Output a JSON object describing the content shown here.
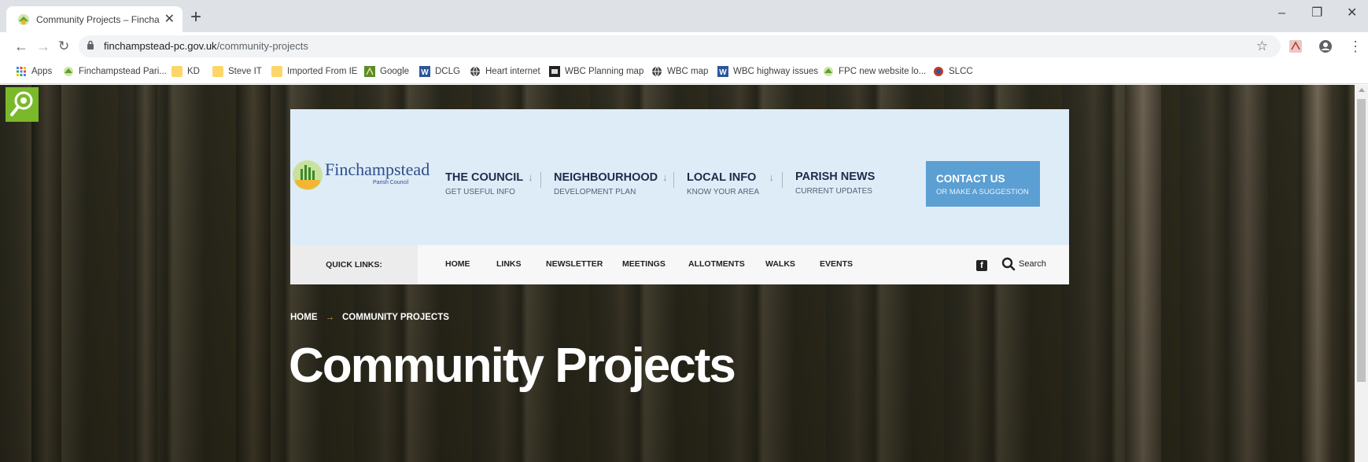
{
  "browser": {
    "tab": {
      "title": "Community Projects – Finchamp..."
    },
    "url_domain": "finchampstead-pc.gov.uk",
    "url_path": "/community-projects",
    "bookmarks": [
      {
        "label": "Apps",
        "icon": "apps-icon"
      },
      {
        "label": "Finchampstead Pari...",
        "icon": "fpc-favicon"
      },
      {
        "label": "KD",
        "icon": "folder-icon"
      },
      {
        "label": "Steve IT",
        "icon": "folder-icon"
      },
      {
        "label": "Imported From IE",
        "icon": "folder-icon"
      },
      {
        "label": "Google",
        "icon": "google-icon"
      },
      {
        "label": "DCLG",
        "icon": "w-icon"
      },
      {
        "label": "Heart internet",
        "icon": "globe-icon"
      },
      {
        "label": "WBC Planning map",
        "icon": "map-icon"
      },
      {
        "label": "WBC map",
        "icon": "globe-icon"
      },
      {
        "label": "WBC highway issues",
        "icon": "w-icon"
      },
      {
        "label": "FPC new website lo...",
        "icon": "fpc-favicon"
      },
      {
        "label": "SLCC",
        "icon": "slcc-icon"
      }
    ]
  },
  "site": {
    "logo": {
      "word": "Finchampstead",
      "sub": "Parish Council"
    },
    "nav": [
      {
        "title": "THE COUNCIL",
        "sub": "GET USEFUL INFO",
        "arrow": "↓"
      },
      {
        "title": "NEIGHBOURHOOD",
        "sub": "DEVELOPMENT PLAN",
        "arrow": "↓"
      },
      {
        "title": "LOCAL INFO",
        "sub": "KNOW YOUR AREA",
        "arrow": "↓"
      },
      {
        "title": "PARISH NEWS",
        "sub": "CURRENT UPDATES",
        "arrow": ""
      }
    ],
    "contact": {
      "title": "CONTACT US",
      "sub": "OR MAKE A SUGGESTION"
    },
    "quick_label": "QUICK LINKS:",
    "quick_links": [
      "HOME",
      "LINKS",
      "NEWSLETTER",
      "MEETINGS",
      "ALLOTMENTS",
      "WALKS",
      "EVENTS"
    ],
    "search_label": "Search",
    "breadcrumb": {
      "home": "HOME",
      "sep": "→",
      "current": "COMMUNITY PROJECTS"
    },
    "page_title": "Community Projects"
  },
  "colors": {
    "header_bg": "#deecf8",
    "contact_bg": "#5b9fd3",
    "accessibility": "#7ab929"
  }
}
